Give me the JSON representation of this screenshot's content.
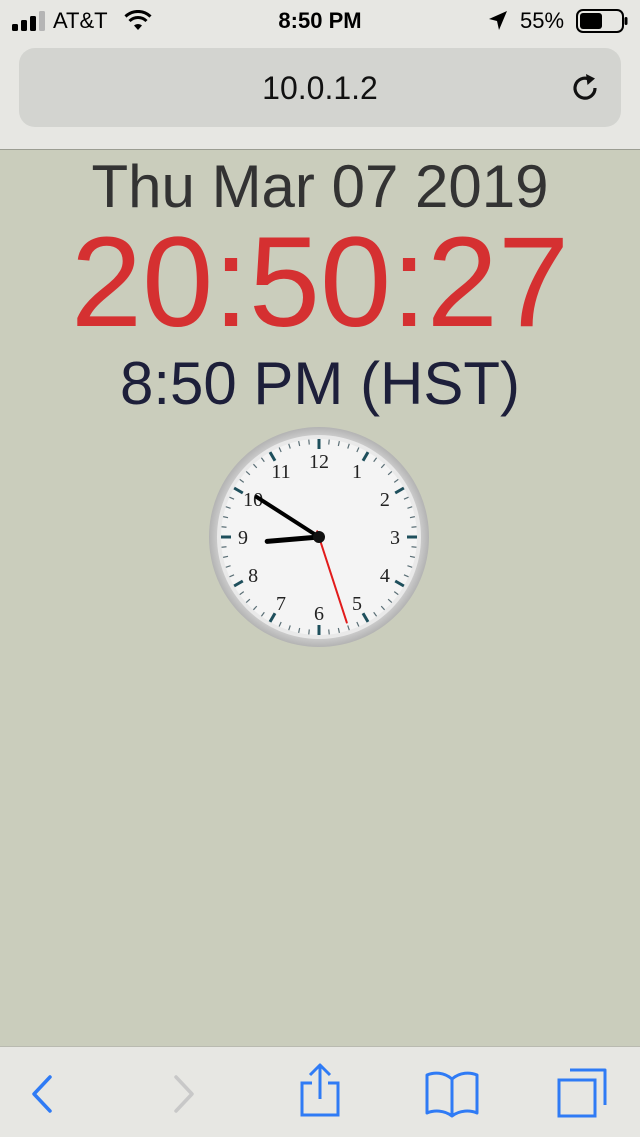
{
  "status_bar": {
    "carrier": "AT&T",
    "time": "8:50 PM",
    "battery_percent": "55%",
    "battery_level": 0.55
  },
  "browser": {
    "url": "10.0.1.2"
  },
  "page": {
    "date": "Thu Mar 07 2019",
    "time_24h": "20:50:27",
    "time_12h": "8:50 PM (HST)",
    "clock": {
      "numerals": [
        "12",
        "1",
        "2",
        "3",
        "4",
        "5",
        "6",
        "7",
        "8",
        "9",
        "10",
        "11"
      ],
      "hours": 20,
      "minutes": 50,
      "seconds": 27
    }
  },
  "colors": {
    "background": "#cacdbc",
    "digital_time": "#d53031",
    "accent_blue": "#2f7bf5"
  },
  "icons": {
    "back": "chevron-left-icon",
    "forward": "chevron-right-icon",
    "share": "share-icon",
    "bookmarks": "book-icon",
    "tabs": "tabs-icon"
  }
}
